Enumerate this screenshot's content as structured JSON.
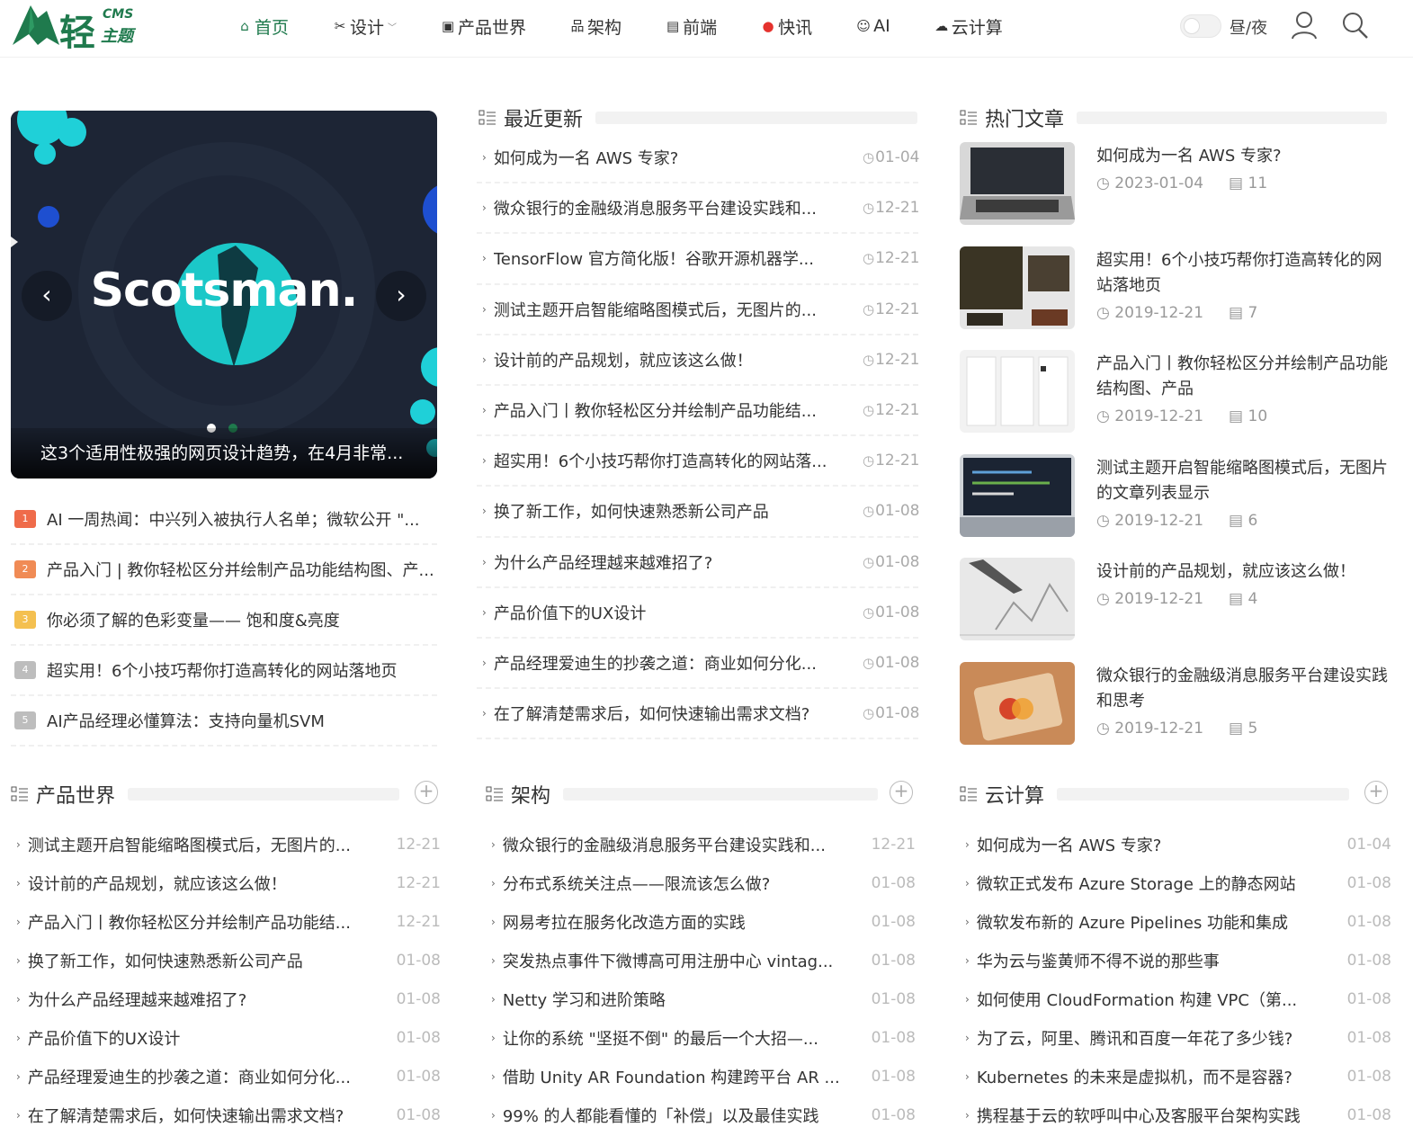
{
  "header": {
    "logo_text": "轻",
    "logo_cms": "CMS",
    "logo_sub": "主题",
    "nav": [
      {
        "label": "首页",
        "icon": "home-icon",
        "active": true
      },
      {
        "label": "设计",
        "icon": "tools-icon",
        "dropdown": true
      },
      {
        "label": "产品世界",
        "icon": "product-icon"
      },
      {
        "label": "架构",
        "icon": "sitemap-icon"
      },
      {
        "label": "前端",
        "icon": "code-icon"
      },
      {
        "label": "快讯",
        "icon": "flame-icon"
      },
      {
        "label": "AI",
        "icon": "robot-icon"
      },
      {
        "label": "云计算",
        "icon": "cloud-icon"
      }
    ],
    "theme_label": "昼/夜"
  },
  "carousel": {
    "brand": "Scotsman.",
    "caption": "这3个适用性极强的网页设计趋势，在4月非常..."
  },
  "left_list": [
    {
      "rank": "1",
      "color": "#ef6b4a",
      "title": "AI 一周热闻：中兴列入被执行人名单；微软公开 \"..."
    },
    {
      "rank": "2",
      "color": "#f08b55",
      "title": "产品入门 | 教你轻松区分并绘制产品功能结构图、产..."
    },
    {
      "rank": "3",
      "color": "#f4c050",
      "title": "你必须了解的色彩变量—— 饱和度&亮度"
    },
    {
      "rank": "4",
      "color": "#bdbdbd",
      "title": "超实用！6个小技巧帮你打造高转化的网站落地页"
    },
    {
      "rank": "5",
      "color": "#bdbdbd",
      "title": "AI产品经理必懂算法：支持向量机SVM"
    }
  ],
  "recent": {
    "title": "最近更新",
    "items": [
      {
        "title": "如何成为一名 AWS 专家?",
        "date": "01-04"
      },
      {
        "title": "微众银行的金融级消息服务平台建设实践和...",
        "date": "12-21"
      },
      {
        "title": "TensorFlow 官方简化版！谷歌开源机器学...",
        "date": "12-21"
      },
      {
        "title": "测试主题开启智能缩略图模式后，无图片的...",
        "date": "12-21"
      },
      {
        "title": "设计前的产品规划，就应该这么做！",
        "date": "12-21"
      },
      {
        "title": "产品入门丨教你轻松区分并绘制产品功能结...",
        "date": "12-21"
      },
      {
        "title": "超实用！6个小技巧帮你打造高转化的网站落...",
        "date": "12-21"
      },
      {
        "title": "换了新工作，如何快速熟悉新公司产品",
        "date": "01-08"
      },
      {
        "title": "为什么产品经理越来越难招了?",
        "date": "01-08"
      },
      {
        "title": "产品价值下的UX设计",
        "date": "01-08"
      },
      {
        "title": "产品经理爱迪生的抄袭之道：商业如何分化...",
        "date": "01-08"
      },
      {
        "title": "在了解清楚需求后，如何快速输出需求文档?",
        "date": "01-08"
      }
    ]
  },
  "hot": {
    "title": "热门文章",
    "items": [
      {
        "title": "如何成为一名 AWS 专家?",
        "date": "2023-01-04",
        "comments": "11"
      },
      {
        "title": "超实用！6个小技巧帮你打造高转化的网站落地页",
        "date": "2019-12-21",
        "comments": "7"
      },
      {
        "title": "产品入门丨教你轻松区分并绘制产品功能结构图、产品",
        "date": "2019-12-21",
        "comments": "10"
      },
      {
        "title": "测试主题开启智能缩略图模式后，无图片的文章列表显示",
        "date": "2019-12-21",
        "comments": "6"
      },
      {
        "title": "设计前的产品规划，就应该这么做！",
        "date": "2019-12-21",
        "comments": "4"
      },
      {
        "title": "微众银行的金融级消息服务平台建设实践和思考",
        "date": "2019-12-21",
        "comments": "5"
      }
    ]
  },
  "product_world": {
    "title": "产品世界",
    "items": [
      {
        "title": "测试主题开启智能缩略图模式后，无图片的...",
        "date": "12-21"
      },
      {
        "title": "设计前的产品规划，就应该这么做！",
        "date": "12-21"
      },
      {
        "title": "产品入门丨教你轻松区分并绘制产品功能结...",
        "date": "12-21"
      },
      {
        "title": "换了新工作，如何快速熟悉新公司产品",
        "date": "01-08"
      },
      {
        "title": "为什么产品经理越来越难招了?",
        "date": "01-08"
      },
      {
        "title": "产品价值下的UX设计",
        "date": "01-08"
      },
      {
        "title": "产品经理爱迪生的抄袭之道：商业如何分化...",
        "date": "01-08"
      },
      {
        "title": "在了解清楚需求后，如何快速输出需求文档?",
        "date": "01-08"
      }
    ]
  },
  "architecture": {
    "title": "架构",
    "items": [
      {
        "title": "微众银行的金融级消息服务平台建设实践和...",
        "date": "12-21"
      },
      {
        "title": "分布式系统关注点——限流该怎么做?",
        "date": "01-08"
      },
      {
        "title": "网易考拉在服务化改造方面的实践",
        "date": "01-08"
      },
      {
        "title": "突发热点事件下微博高可用注册中心 vintag...",
        "date": "01-08"
      },
      {
        "title": "Netty 学习和进阶策略",
        "date": "01-08"
      },
      {
        "title": "让你的系统 \"坚挺不倒\" 的最后一个大招—...",
        "date": "01-08"
      },
      {
        "title": "借助 Unity AR Foundation 构建跨平台 AR ...",
        "date": "01-08"
      },
      {
        "title": "99% 的人都能看懂的「补偿」以及最佳实践",
        "date": "01-08"
      }
    ]
  },
  "cloud": {
    "title": "云计算",
    "items": [
      {
        "title": "如何成为一名 AWS 专家?",
        "date": "01-04"
      },
      {
        "title": "微软正式发布 Azure Storage 上的静态网站",
        "date": "01-08"
      },
      {
        "title": "微软发布新的 Azure Pipelines 功能和集成",
        "date": "01-08"
      },
      {
        "title": "华为云与鉴黄师不得不说的那些事",
        "date": "01-08"
      },
      {
        "title": "如何使用 CloudFormation 构建 VPC（第...",
        "date": "01-08"
      },
      {
        "title": "为了云，阿里、腾讯和百度一年花了多少钱?",
        "date": "01-08"
      },
      {
        "title": "Kubernetes 的未来是虚拟机，而不是容器?",
        "date": "01-08"
      },
      {
        "title": "携程基于云的软呼叫中心及客服平台架构实践",
        "date": "01-08"
      }
    ]
  },
  "colors": {
    "brand": "#1f7a4d",
    "accent_hot": "#e5322d"
  }
}
